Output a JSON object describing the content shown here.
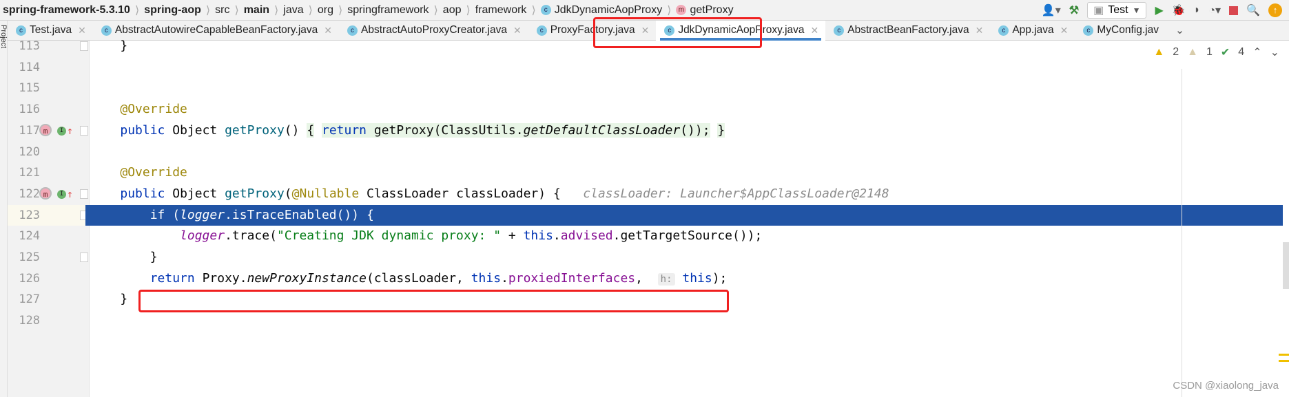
{
  "breadcrumb": [
    {
      "label": "spring-framework-5.3.10",
      "bold": true
    },
    {
      "label": "spring-aop",
      "bold": true
    },
    {
      "label": "src"
    },
    {
      "label": "main",
      "bold": true
    },
    {
      "label": "java"
    },
    {
      "label": "org"
    },
    {
      "label": "springframework"
    },
    {
      "label": "aop"
    },
    {
      "label": "framework"
    },
    {
      "label": "JdkDynamicAopProxy",
      "icon": "class-icon"
    },
    {
      "label": "getProxy",
      "icon": "method-icon"
    }
  ],
  "toolbar": {
    "run_config": "Test"
  },
  "project_strip": "Project",
  "tabs": [
    {
      "label": "Test.java"
    },
    {
      "label": "AbstractAutowireCapableBeanFactory.java"
    },
    {
      "label": "AbstractAutoProxyCreator.java"
    },
    {
      "label": "ProxyFactory.java"
    },
    {
      "label": "JdkDynamicAopProxy.java",
      "active": true
    },
    {
      "label": "AbstractBeanFactory.java"
    },
    {
      "label": "App.java"
    },
    {
      "label": "MyConfig.jav"
    }
  ],
  "inspections": {
    "warnings": "2",
    "weak_warnings": "1",
    "typos": "4"
  },
  "lines": [
    {
      "n": "113",
      "tokens": [
        {
          "t": "    }"
        }
      ]
    },
    {
      "n": "114",
      "tokens": []
    },
    {
      "n": "115",
      "tokens": []
    },
    {
      "n": "116",
      "tokens": [
        {
          "t": "    "
        },
        {
          "t": "@Override",
          "c": "an"
        }
      ]
    },
    {
      "n": "117",
      "icons": true,
      "tokens": [
        {
          "t": "    "
        },
        {
          "t": "public",
          "c": "kw"
        },
        {
          "t": " Object "
        },
        {
          "t": "getProxy",
          "c": "fn"
        },
        {
          "t": "() "
        },
        {
          "t": "{",
          "c": "fb"
        },
        {
          "t": " "
        },
        {
          "t": "return",
          "c": "kw fb"
        },
        {
          "t": " getProxy(ClassUtils.",
          "c": "fb"
        },
        {
          "t": "getDefaultClassLoader",
          "c": "it fb"
        },
        {
          "t": "());",
          "c": "fb"
        },
        {
          "t": " "
        },
        {
          "t": "}",
          "c": "fb"
        }
      ]
    },
    {
      "n": "120",
      "tokens": []
    },
    {
      "n": "121",
      "tokens": [
        {
          "t": "    "
        },
        {
          "t": "@Override",
          "c": "an"
        }
      ]
    },
    {
      "n": "122",
      "icons": true,
      "tokens": [
        {
          "t": "    "
        },
        {
          "t": "public",
          "c": "kw"
        },
        {
          "t": " Object "
        },
        {
          "t": "getProxy",
          "c": "fn"
        },
        {
          "t": "("
        },
        {
          "t": "@Nullable",
          "c": "an"
        },
        {
          "t": " ClassLoader classLoader) {   "
        },
        {
          "t": "classLoader: Launcher$AppClassLoader@2148",
          "c": "hint"
        }
      ]
    },
    {
      "n": "123",
      "selected": true,
      "tokens": [
        {
          "t": "        if ("
        },
        {
          "t": "logger",
          "c": "it"
        },
        {
          "t": ".isTraceEnabled()) {"
        }
      ]
    },
    {
      "n": "124",
      "tokens": [
        {
          "t": "            "
        },
        {
          "t": "logger",
          "c": "lg"
        },
        {
          "t": ".trace("
        },
        {
          "t": "\"Creating JDK dynamic proxy: \"",
          "c": "st"
        },
        {
          "t": " + "
        },
        {
          "t": "this",
          "c": "kw"
        },
        {
          "t": "."
        },
        {
          "t": "advised",
          "c": "fd"
        },
        {
          "t": ".getTargetSource());"
        }
      ]
    },
    {
      "n": "125",
      "tokens": [
        {
          "t": "        }"
        }
      ]
    },
    {
      "n": "126",
      "tokens": [
        {
          "t": "        "
        },
        {
          "t": "return",
          "c": "kw"
        },
        {
          "t": " Proxy."
        },
        {
          "t": "newProxyInstance",
          "c": "it"
        },
        {
          "t": "(classLoader, "
        },
        {
          "t": "this",
          "c": "kw"
        },
        {
          "t": "."
        },
        {
          "t": "proxiedInterfaces",
          "c": "fd"
        },
        {
          "t": ",  "
        },
        {
          "t": "h:",
          "c": "ih"
        },
        {
          "t": " "
        },
        {
          "t": "this",
          "c": "kw"
        },
        {
          "t": ");"
        }
      ]
    },
    {
      "n": "127",
      "tokens": [
        {
          "t": "    }"
        }
      ]
    },
    {
      "n": "128",
      "tokens": []
    }
  ],
  "watermark": "CSDN @xiaolong_java",
  "colors": {
    "selection": "#2154a5",
    "highlight_box": "#f02020",
    "tab_underline": "#4083c9"
  }
}
